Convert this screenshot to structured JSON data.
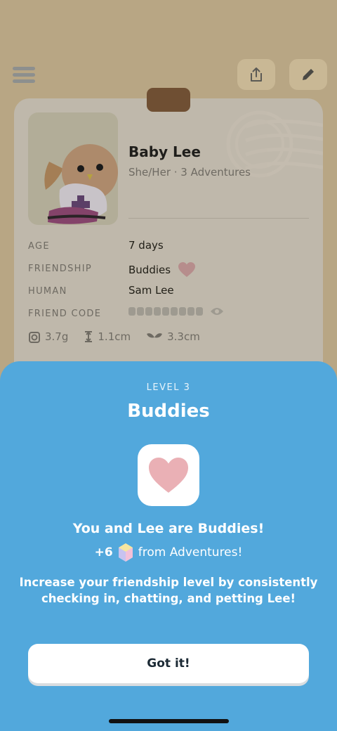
{
  "background": {
    "menu_icon": "hamburger-menu-icon",
    "share_icon": "share-icon",
    "edit_icon": "pencil-icon",
    "profile": {
      "name": "Baby Lee",
      "subtitle": "She/Her · 3 Adventures",
      "fields": [
        {
          "label": "AGE",
          "value": "7 days"
        },
        {
          "label": "FRIENDSHIP",
          "value": "Buddies"
        },
        {
          "label": "HUMAN",
          "value": "Sam Lee"
        },
        {
          "label": "FRIEND CODE",
          "value": ""
        }
      ],
      "stats": {
        "weight": "3.7g",
        "height": "1.1cm",
        "wingspan": "3.3cm"
      }
    }
  },
  "modal": {
    "level_label": "LEVEL 3",
    "title": "Buddies",
    "headline": "You and Lee are Buddies!",
    "reward_amount": "+6",
    "reward_text": "from Adventures!",
    "body": "Increase your friendship level by consistently checking in, chatting, and petting Lee!",
    "button_label": "Got it!"
  },
  "colors": {
    "sheet": "#52a8dc",
    "heart": "#eab0b5",
    "backdrop": "#b8a684"
  }
}
